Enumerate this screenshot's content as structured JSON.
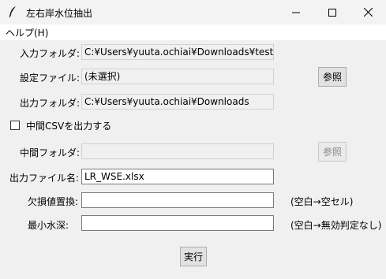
{
  "window": {
    "title": "左右岸水位抽出",
    "controls": [
      "minimize-icon",
      "maximize-icon",
      "close-icon"
    ]
  },
  "menu": {
    "help": "ヘルプ(H)"
  },
  "form": {
    "input_folder": {
      "label": "入力フォルダ:",
      "value": "C:¥Users¥yuuta.ochiai¥Downloads¥test-12"
    },
    "settings_file": {
      "label": "設定ファイル:",
      "value": "(未選択)",
      "browse": "参照"
    },
    "output_folder": {
      "label": "出力フォルダ:",
      "value": "C:¥Users¥yuuta.ochiai¥Downloads"
    },
    "intermediate_csv": {
      "label": "中間CSVを出力する",
      "checked": false
    },
    "intermediate_folder": {
      "label": "中間フォルダ:",
      "value": "",
      "browse": "参照"
    },
    "output_filename": {
      "label": "出力ファイル名:",
      "value": "LR_WSE.xlsx"
    },
    "missing_value": {
      "label": "欠損値置換:",
      "value": "",
      "hint": "(空白→空セル)"
    },
    "min_depth": {
      "label": "最小水深:",
      "value": "",
      "hint": "(空白→無効判定なし)"
    },
    "run": "実行"
  }
}
